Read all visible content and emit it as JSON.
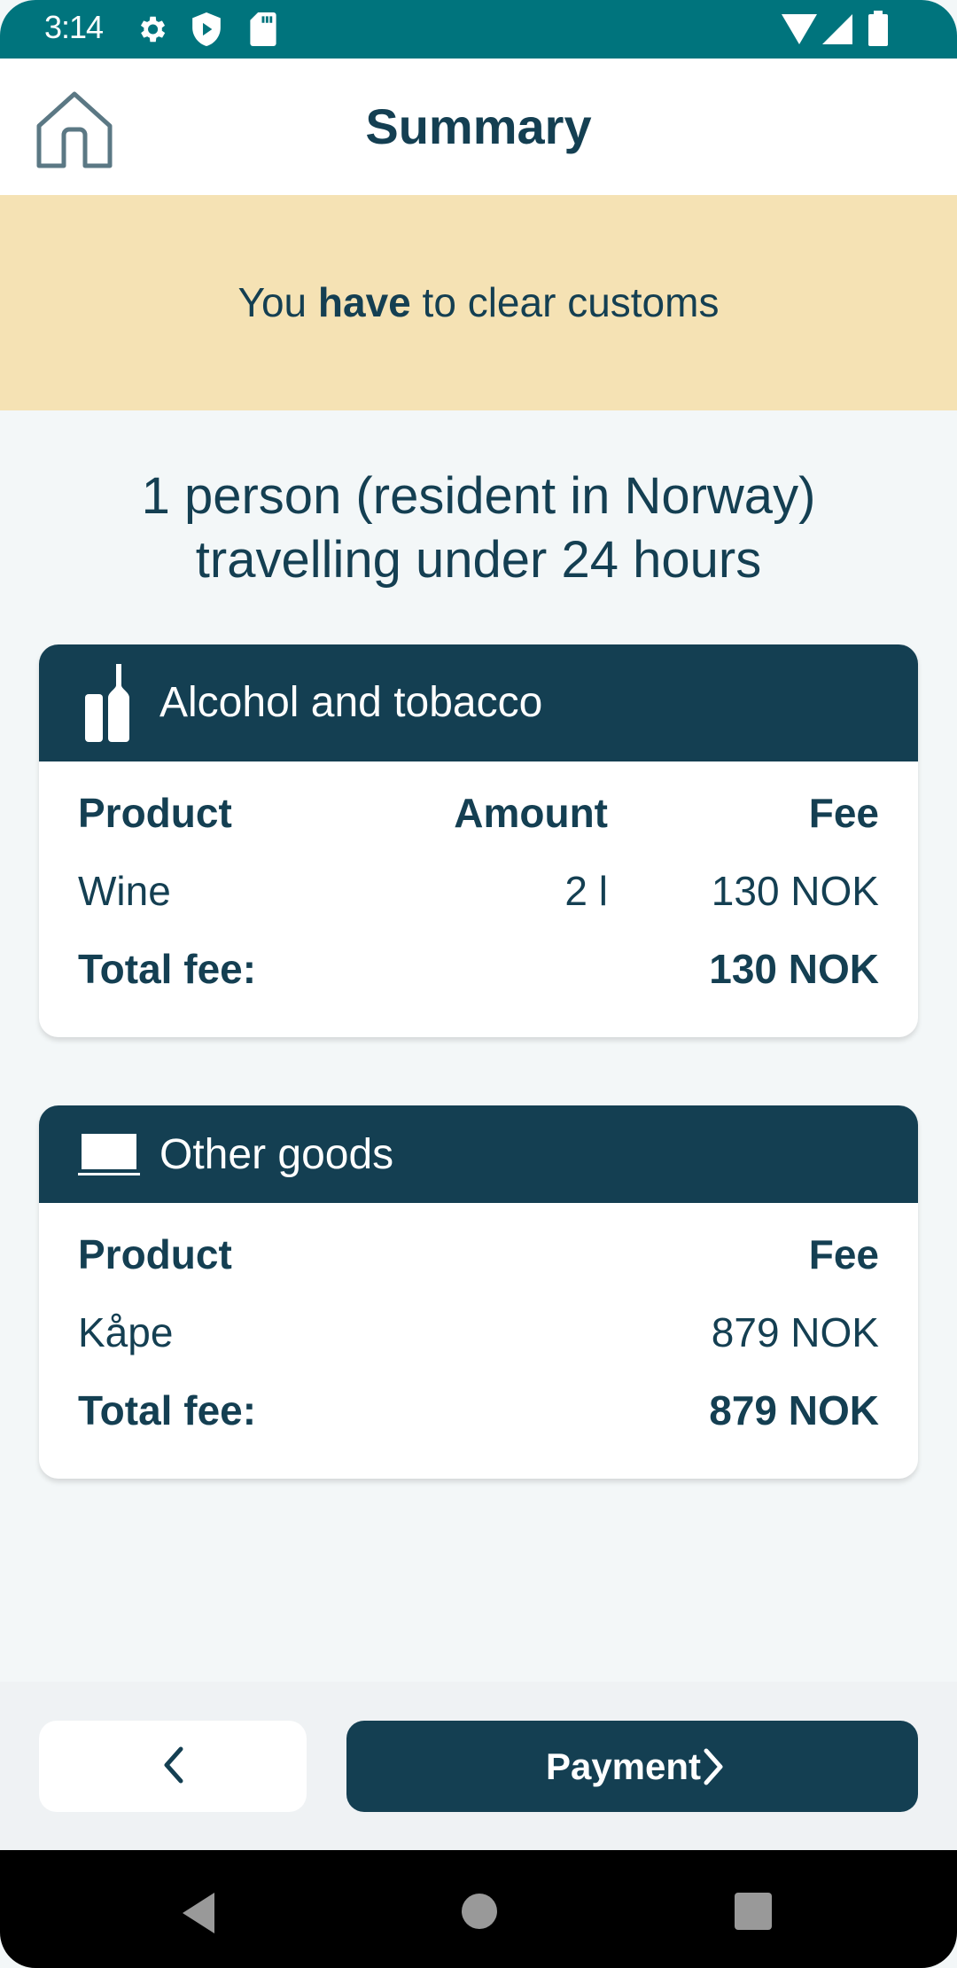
{
  "status_bar": {
    "time": "3:14",
    "icons": [
      "gear-icon",
      "shield-play-icon",
      "sd-card-icon",
      "wifi-icon",
      "cellular-icon",
      "battery-icon"
    ]
  },
  "app_bar": {
    "title": "Summary",
    "home_icon": "home-icon"
  },
  "banner": {
    "prefix": "You ",
    "emphasis": "have",
    "suffix": " to clear customs"
  },
  "traveller": {
    "line1": "1 person (resident in Norway)",
    "line2": "travelling under 24 hours"
  },
  "alcohol_card": {
    "icon": "bottles-icon",
    "title": "Alcohol and tobacco",
    "headers": {
      "product": "Product",
      "amount": "Amount",
      "fee": "Fee"
    },
    "rows": [
      {
        "product": "Wine",
        "amount": "2 l",
        "fee": "130 NOK"
      }
    ],
    "total_label": "Total fee:",
    "total_value": "130 NOK"
  },
  "other_card": {
    "icon": "laptop-icon",
    "title": "Other goods",
    "headers": {
      "product": "Product",
      "fee": "Fee"
    },
    "rows": [
      {
        "product": "Kåpe",
        "fee": "879 NOK"
      }
    ],
    "total_label": "Total fee:",
    "total_value": "879 NOK"
  },
  "footer": {
    "back_icon": "chevron-left-icon",
    "payment_label": "Payment",
    "payment_icon": "chevron-right-icon"
  },
  "nav_bar": {
    "buttons": [
      "back-triangle-icon",
      "home-circle-icon",
      "recents-square-icon"
    ]
  },
  "colors": {
    "status_bar": "#00747d",
    "primary": "#143f52",
    "banner": "#f5e2b4",
    "background": "#f3f7f8"
  }
}
